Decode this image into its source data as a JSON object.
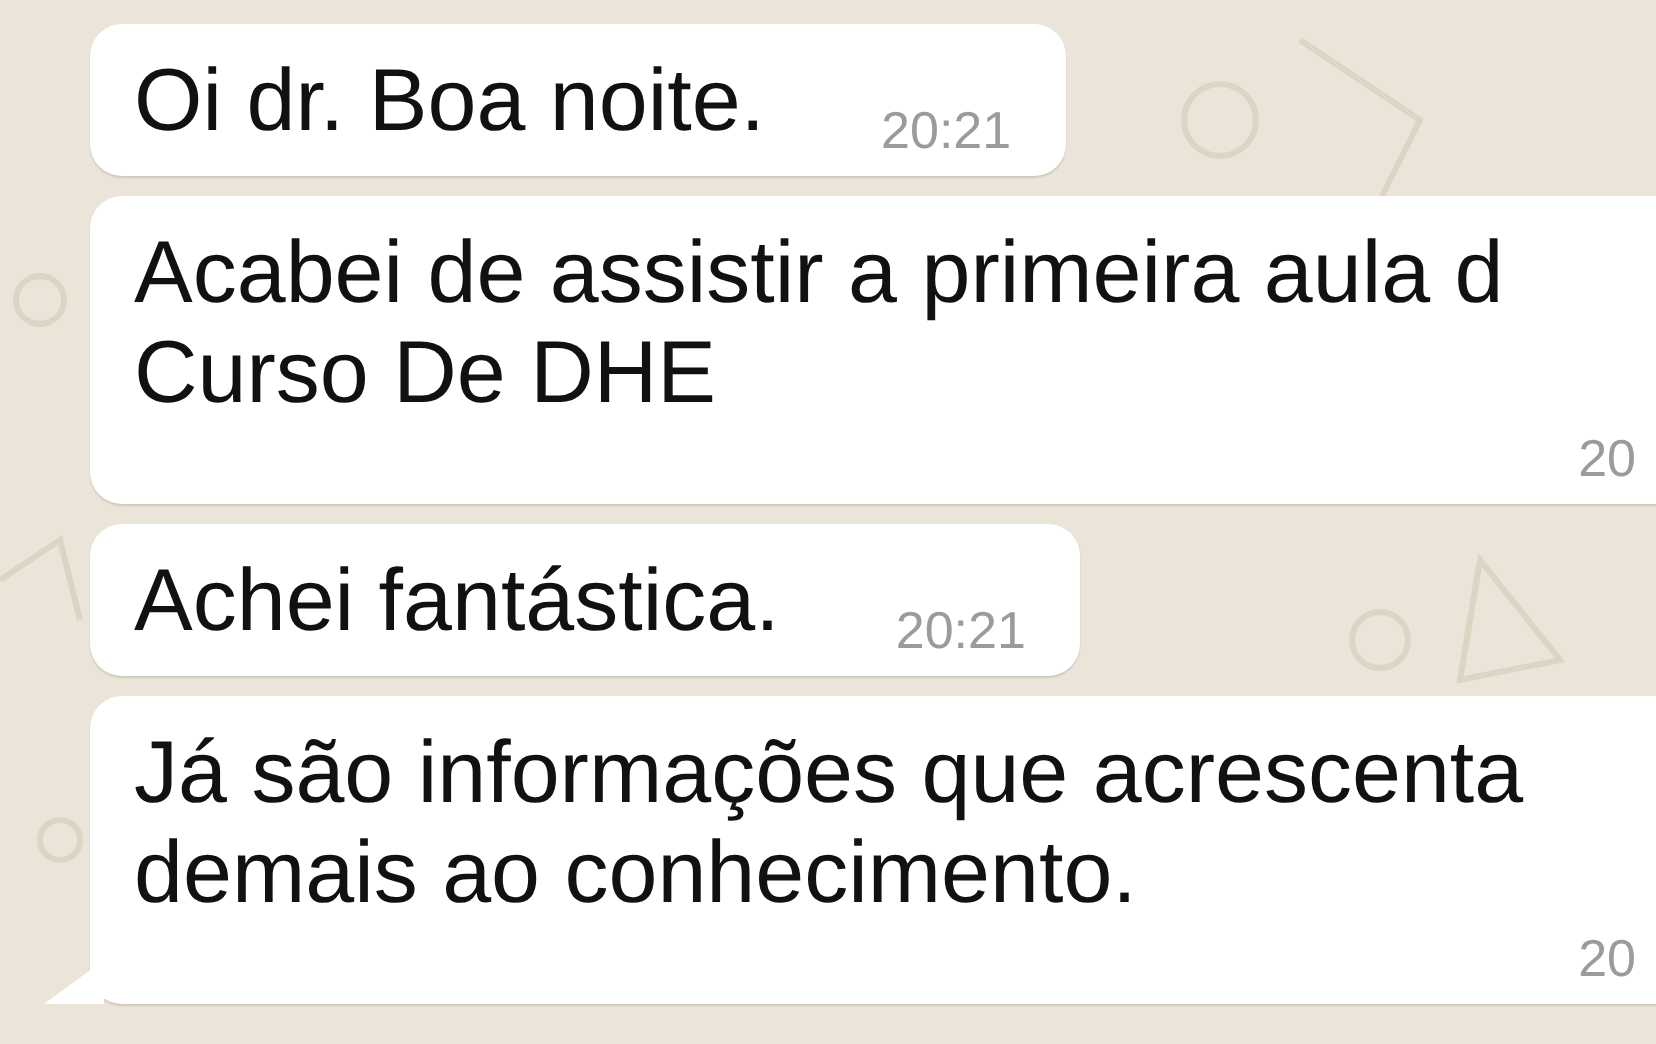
{
  "messages": [
    {
      "text": "Oi dr. Boa noite.",
      "time": "20:21",
      "tail": false
    },
    {
      "text": "Acabei de assistir a primeira aula d\nCurso De DHE",
      "time": "20",
      "tail": false
    },
    {
      "text": "Achei fantástica.",
      "time": "20:21",
      "tail": false
    },
    {
      "text": "Já são informações que acrescenta\ndemais ao conhecimento.",
      "time": "20",
      "tail": true
    }
  ]
}
